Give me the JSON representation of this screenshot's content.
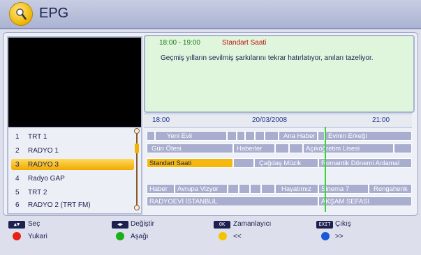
{
  "header": {
    "title": "EPG"
  },
  "info": {
    "time_range": "18:00 - 19:00",
    "program_title": "Standart Saati",
    "description": "Geçmiş yılların sevilmiş şarkılarını tekrar hatırlatıyor, anıları tazeliyor."
  },
  "timeline": {
    "start": "18:00",
    "date": "20/03/2008",
    "end": "21:00"
  },
  "channels": [
    {
      "num": "1",
      "name": "TRT 1",
      "selected": false
    },
    {
      "num": "2",
      "name": "RADYO 1",
      "selected": false
    },
    {
      "num": "3",
      "name": "RADYO 3",
      "selected": true
    },
    {
      "num": "4",
      "name": "Radyo GAP",
      "selected": false
    },
    {
      "num": "5",
      "name": "TRT 2",
      "selected": false
    },
    {
      "num": "6",
      "name": "RADYO 2 (TRT FM)",
      "selected": false
    }
  ],
  "guide": {
    "row1": [
      "Yeni Evli",
      "Ana Haber",
      "Evinin Erkeği"
    ],
    "row2": [
      "Gün Ötesi",
      "Haberler",
      "Açıköğretim Lisesi"
    ],
    "row3": [
      "Standart Saati",
      "Çağdaş Müzik",
      "Romantik Dönemi Anlamal"
    ],
    "row5": [
      "Haber",
      "Avrupa Vizyor",
      "Hayatımız",
      "Sinema 7",
      "Rengahenk"
    ],
    "row6": [
      "RADYOEVİ İSTANBUL",
      "AKŞAM SEFASI"
    ]
  },
  "legend": {
    "select": "Seç",
    "change": "Değiştir",
    "timer": "Zamanlayıcı",
    "exit": "Çıkış",
    "up": "Yukari",
    "down": "Aşağı",
    "prev": "<<",
    "next": ">>",
    "key_ok": "OK",
    "key_exit": "EXIT"
  },
  "colors": {
    "red": "#e8201a",
    "green": "#1ab01a",
    "yellow": "#f5c400",
    "blue": "#1a58d8",
    "accent": "#f5b810"
  }
}
